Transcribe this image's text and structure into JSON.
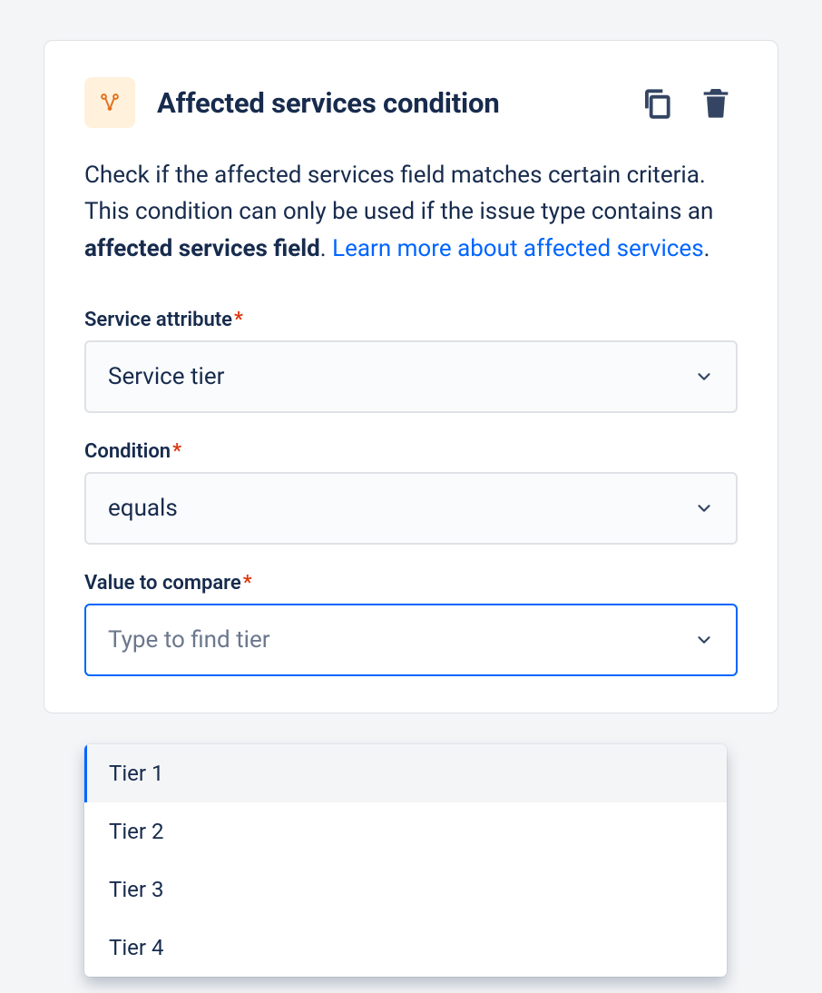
{
  "card": {
    "icon_name": "rules-icon",
    "title": "Affected services condition",
    "description_pre": "Check if the affected services field matches certain criteria. This condition can only be used if the issue type contains an ",
    "description_bold": "affected services field",
    "description_post": ". ",
    "learn_more": "Learn more about affected services",
    "period": ".",
    "fields": {
      "service_attribute": {
        "label": "Service attribute",
        "value": "Service tier"
      },
      "condition": {
        "label": "Condition",
        "value": "equals"
      },
      "value_to_compare": {
        "label": "Value to compare",
        "placeholder": "Type to find tier"
      }
    }
  },
  "dropdown": {
    "options": [
      "Tier 1",
      "Tier 2",
      "Tier 3",
      "Tier 4"
    ],
    "highlighted_index": 0
  }
}
